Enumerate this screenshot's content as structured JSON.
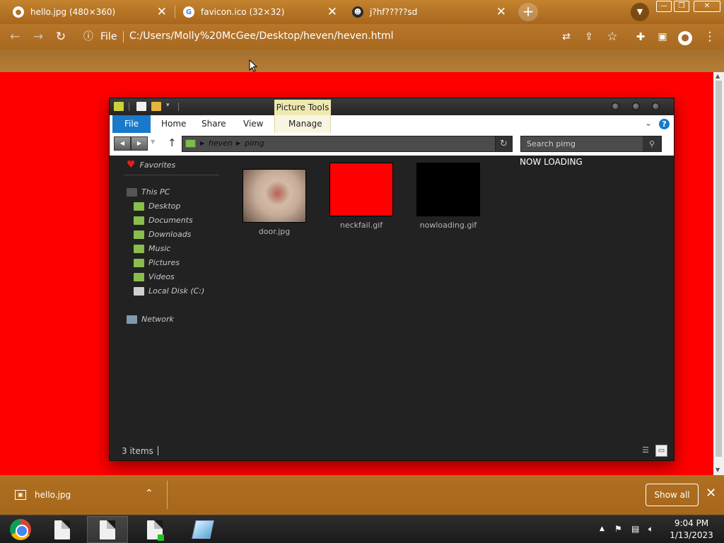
{
  "browser": {
    "tabs": [
      {
        "title": "hello.jpg (480×360)",
        "icon": "chrome-icon"
      },
      {
        "title": "favicon.ico (32×32)",
        "icon": "google-icon"
      },
      {
        "title": "j?hf?????sd",
        "icon": "face-icon"
      }
    ],
    "omnibox": {
      "scheme_label": "File",
      "url": "C:/Users/Molly%20McGee/Desktop/heven/heven.html"
    }
  },
  "explorer": {
    "context_tab": "Picture Tools",
    "ribbon_tabs": [
      "File",
      "Home",
      "Share",
      "View"
    ],
    "context_ribbon_tab": "Manage",
    "breadcrumb": [
      "heven",
      "pimg"
    ],
    "search_placeholder": "Search pimg",
    "nav": {
      "favorites": "Favorites",
      "this_pc": "This PC",
      "pc_items": [
        "Desktop",
        "Documents",
        "Downloads",
        "Music",
        "Pictures",
        "Videos",
        "Local Disk (C:)"
      ],
      "network": "Network"
    },
    "files": [
      {
        "name": "door.jpg"
      },
      {
        "name": "neckfail.gif"
      },
      {
        "name": "nowloading.gif"
      }
    ],
    "overlay_text": "NOW LOADING",
    "status": "3 items"
  },
  "downloads": {
    "file": "hello.jpg",
    "show_all_label": "Show all"
  },
  "taskbar": {
    "time": "9:04 PM",
    "date": "1/13/2023"
  },
  "colors": {
    "page_bg": "#ff0000",
    "chrome_theme": "#b07022",
    "file_tab": "#1979ca",
    "picture_tools": "#eee9b0"
  }
}
